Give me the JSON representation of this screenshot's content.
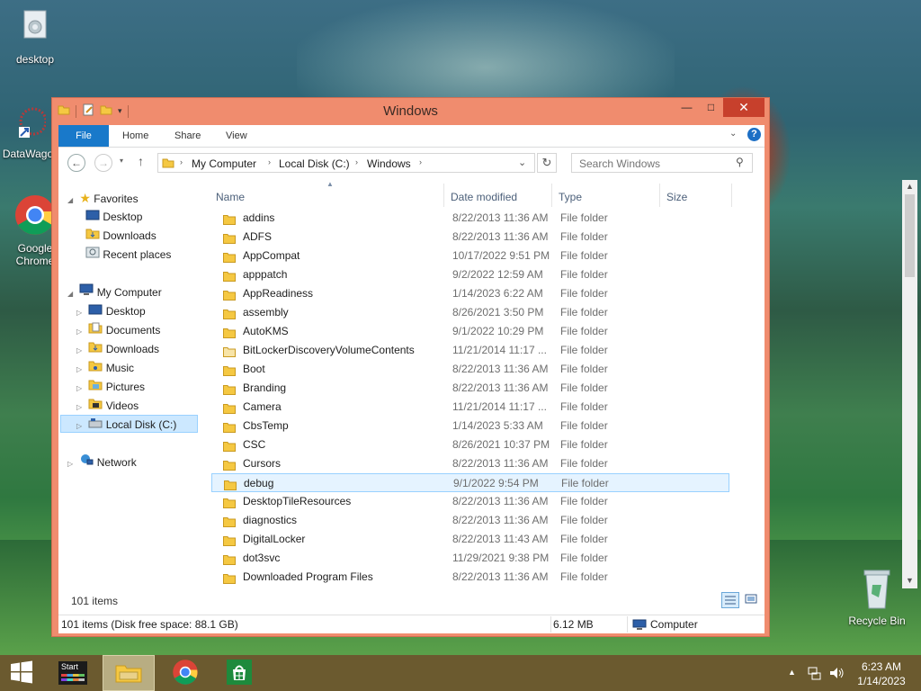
{
  "desktop": {
    "icons": [
      {
        "label": "desktop"
      },
      {
        "label": "DataWago"
      },
      {
        "label": "Google Chrome"
      },
      {
        "label": "Recycle Bin"
      }
    ]
  },
  "window": {
    "title": "Windows",
    "buttons": {
      "minimize": "—",
      "maximize": "□",
      "close": "✕"
    },
    "ribbon_tabs": [
      "File",
      "Home",
      "Share",
      "View"
    ],
    "address": {
      "crumbs": [
        "My Computer",
        "Local Disk (C:)",
        "Windows"
      ]
    },
    "search": {
      "placeholder": "Search Windows"
    },
    "nav": {
      "favorites_label": "Favorites",
      "favorites": [
        "Desktop",
        "Downloads",
        "Recent places"
      ],
      "computer_label": "My Computer",
      "computer": [
        "Desktop",
        "Documents",
        "Downloads",
        "Music",
        "Pictures",
        "Videos",
        "Local Disk (C:)"
      ],
      "network_label": "Network"
    },
    "columns": [
      "Name",
      "Date modified",
      "Type",
      "Size"
    ],
    "files": [
      {
        "name": "addins",
        "date": "8/22/2013 11:36 AM",
        "type": "File folder"
      },
      {
        "name": "ADFS",
        "date": "8/22/2013 11:36 AM",
        "type": "File folder"
      },
      {
        "name": "AppCompat",
        "date": "10/17/2022 9:51 PM",
        "type": "File folder"
      },
      {
        "name": "apppatch",
        "date": "9/2/2022 12:59 AM",
        "type": "File folder"
      },
      {
        "name": "AppReadiness",
        "date": "1/14/2023 6:22 AM",
        "type": "File folder"
      },
      {
        "name": "assembly",
        "date": "8/26/2021 3:50 PM",
        "type": "File folder"
      },
      {
        "name": "AutoKMS",
        "date": "9/1/2022 10:29 PM",
        "type": "File folder"
      },
      {
        "name": "BitLockerDiscoveryVolumeContents",
        "date": "11/21/2014 11:17 ...",
        "type": "File folder"
      },
      {
        "name": "Boot",
        "date": "8/22/2013 11:36 AM",
        "type": "File folder"
      },
      {
        "name": "Branding",
        "date": "8/22/2013 11:36 AM",
        "type": "File folder"
      },
      {
        "name": "Camera",
        "date": "11/21/2014 11:17 ...",
        "type": "File folder"
      },
      {
        "name": "CbsTemp",
        "date": "1/14/2023 5:33 AM",
        "type": "File folder"
      },
      {
        "name": "CSC",
        "date": "8/26/2021 10:37 PM",
        "type": "File folder"
      },
      {
        "name": "Cursors",
        "date": "8/22/2013 11:36 AM",
        "type": "File folder"
      },
      {
        "name": "debug",
        "date": "9/1/2022 9:54 PM",
        "type": "File folder"
      },
      {
        "name": "DesktopTileResources",
        "date": "8/22/2013 11:36 AM",
        "type": "File folder"
      },
      {
        "name": "diagnostics",
        "date": "8/22/2013 11:36 AM",
        "type": "File folder"
      },
      {
        "name": "DigitalLocker",
        "date": "8/22/2013 11:43 AM",
        "type": "File folder"
      },
      {
        "name": "dot3svc",
        "date": "11/29/2021 9:38 PM",
        "type": "File folder"
      },
      {
        "name": "Downloaded Program Files",
        "date": "8/22/2013 11:36 AM",
        "type": "File folder"
      }
    ],
    "selected_file": "debug",
    "item_count": "101 items",
    "status": {
      "left": "101 items (Disk free space: 88.1 GB)",
      "size": "6.12 MB",
      "location": "Computer"
    }
  },
  "taskbar": {
    "start_label": "Start",
    "time": "6:23 AM",
    "date": "1/14/2023"
  },
  "colors": {
    "window_frame": "#f08c6e",
    "close_button": "#c7402c",
    "file_tab": "#1979ca",
    "selection": "#cce8ff",
    "taskbar": "#6b5a2f"
  }
}
